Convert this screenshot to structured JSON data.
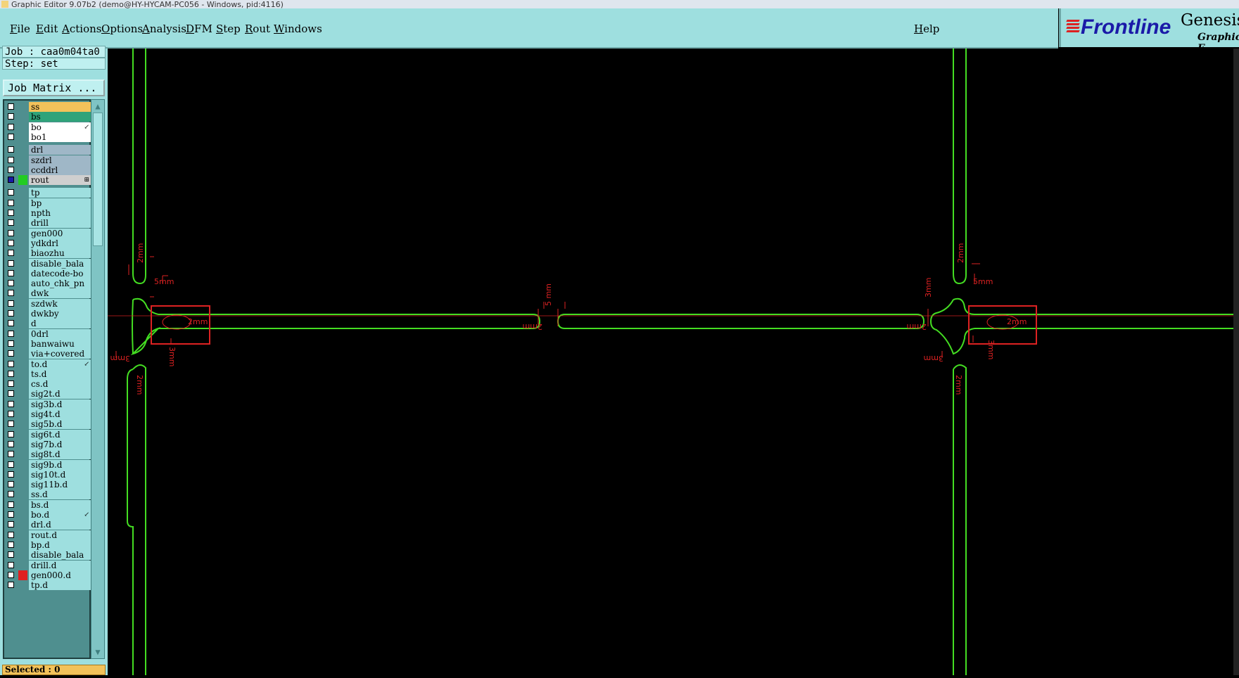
{
  "window": {
    "title": "Graphic Editor 9.07b2 (demo@HY-HYCAM-PC056 - Windows, pid:4116)"
  },
  "menu": {
    "items": [
      "File",
      "Edit",
      "Actions",
      "Options",
      "Analysis",
      "DFM",
      "Step",
      "Rout",
      "Windows"
    ],
    "help": "Help"
  },
  "logo": {
    "brand": "Frontline",
    "product": "Genesis",
    "sub": "Graphic E"
  },
  "job": {
    "job_label": "Job : caa0m04ta0",
    "step_label": "Step: set",
    "matrix_button": "Job Matrix ..."
  },
  "layers": [
    {
      "name": "ss",
      "color": "#f2c25a",
      "group": 1
    },
    {
      "name": "bs",
      "color": "#2fa37a",
      "group": 1
    },
    {
      "name": "bo",
      "color": "#ffffff",
      "group": 1,
      "mark": "↙"
    },
    {
      "name": "bo1",
      "color": "#ffffff",
      "group": 1
    },
    {
      "name": "drl",
      "color": "#9fb7c7",
      "group": 2
    },
    {
      "name": "szdrl",
      "color": "#9fb7c7",
      "group": 2
    },
    {
      "name": "ccddrl",
      "color": "#9fb7c7",
      "group": 2
    },
    {
      "name": "rout",
      "color": "#cfcfcf",
      "group": 2,
      "checked": true,
      "swatch": "#22cc22",
      "mark": "⊞"
    },
    {
      "name": "tp",
      "color": "#9edfdf",
      "group": 3
    },
    {
      "name": "bp",
      "color": "#9edfdf",
      "group": 3
    },
    {
      "name": "npth",
      "color": "#9edfdf",
      "group": 3
    },
    {
      "name": "drill",
      "color": "#9edfdf",
      "group": 3
    },
    {
      "name": "gen000",
      "color": "#9edfdf",
      "group": 3
    },
    {
      "name": "ydkdrl",
      "color": "#9edfdf",
      "group": 3
    },
    {
      "name": "biaozhu",
      "color": "#9edfdf",
      "group": 3
    },
    {
      "name": "disable_bala",
      "color": "#9edfdf",
      "group": 3
    },
    {
      "name": "datecode-bo",
      "color": "#9edfdf",
      "group": 3
    },
    {
      "name": "auto_chk_pn",
      "color": "#9edfdf",
      "group": 3
    },
    {
      "name": "dwk",
      "color": "#9edfdf",
      "group": 3
    },
    {
      "name": "szdwk",
      "color": "#9edfdf",
      "group": 3
    },
    {
      "name": "dwkby",
      "color": "#9edfdf",
      "group": 3
    },
    {
      "name": "d",
      "color": "#9edfdf",
      "group": 3
    },
    {
      "name": "0drl",
      "color": "#9edfdf",
      "group": 3
    },
    {
      "name": "banwaiwu",
      "color": "#9edfdf",
      "group": 3
    },
    {
      "name": "via+covered",
      "color": "#9edfdf",
      "group": 3
    },
    {
      "name": "to.d",
      "color": "#9edfdf",
      "group": 3,
      "mark": "↙"
    },
    {
      "name": "ts.d",
      "color": "#9edfdf",
      "group": 3
    },
    {
      "name": "cs.d",
      "color": "#9edfdf",
      "group": 3
    },
    {
      "name": "sig2t.d",
      "color": "#9edfdf",
      "group": 3
    },
    {
      "name": "sig3b.d",
      "color": "#9edfdf",
      "group": 3
    },
    {
      "name": "sig4t.d",
      "color": "#9edfdf",
      "group": 3
    },
    {
      "name": "sig5b.d",
      "color": "#9edfdf",
      "group": 3
    },
    {
      "name": "sig6t.d",
      "color": "#9edfdf",
      "group": 3
    },
    {
      "name": "sig7b.d",
      "color": "#9edfdf",
      "group": 3
    },
    {
      "name": "sig8t.d",
      "color": "#9edfdf",
      "group": 3
    },
    {
      "name": "sig9b.d",
      "color": "#9edfdf",
      "group": 3
    },
    {
      "name": "sig10t.d",
      "color": "#9edfdf",
      "group": 3
    },
    {
      "name": "sig11b.d",
      "color": "#9edfdf",
      "group": 3
    },
    {
      "name": "ss.d",
      "color": "#9edfdf",
      "group": 3
    },
    {
      "name": "bs.d",
      "color": "#9edfdf",
      "group": 3
    },
    {
      "name": "bo.d",
      "color": "#9edfdf",
      "group": 3,
      "mark": "↙"
    },
    {
      "name": "drl.d",
      "color": "#9edfdf",
      "group": 3
    },
    {
      "name": "rout.d",
      "color": "#9edfdf",
      "group": 3
    },
    {
      "name": "bp.d",
      "color": "#9edfdf",
      "group": 3
    },
    {
      "name": "disable_bala",
      "color": "#9edfdf",
      "group": 3
    },
    {
      "name": "drill.d",
      "color": "#9edfdf",
      "group": 3
    },
    {
      "name": "gen000.d",
      "color": "#9edfdf",
      "group": 3,
      "swatch": "#e02020"
    },
    {
      "name": "tp.d",
      "color": "#9edfdf",
      "group": 3
    }
  ],
  "status": {
    "selected": "Selected : 0"
  },
  "canvas": {
    "route_color": "#44dd22",
    "annotation_color": "#dd2222",
    "dims": {
      "left_top_2mm": "2mm",
      "left_5mm": "5mm",
      "left_box_2mm": "2mm",
      "left_3mm": "3mm",
      "left_bottom_2mm": "2mm",
      "left_box_bottom": "3mm",
      "mid_left_2mm": "2mm",
      "mid_top_5mm": "5 mm",
      "right_2mm_horiz": "2mm",
      "right_top_2mm": "2mm",
      "right_3mm": "3mm",
      "right_5mm": "5mm",
      "right_box_2mm": "2mm",
      "right_lower_3mm": "3mm",
      "right_bottom_2mm": "2mm",
      "right_box_bottom": "3mm"
    }
  }
}
